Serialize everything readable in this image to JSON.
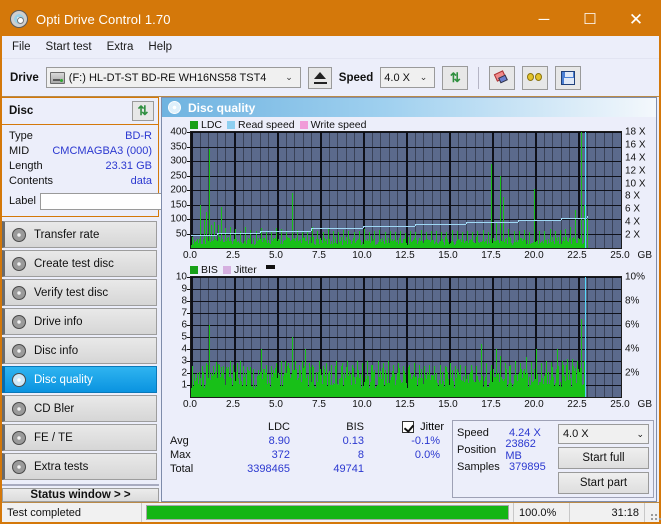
{
  "window": {
    "title": "Opti Drive Control 1.70",
    "icon": "disc-icon",
    "minimize": "─",
    "maximize": "☐",
    "close": "✕"
  },
  "menu": {
    "items": [
      "File",
      "Start test",
      "Extra",
      "Help"
    ]
  },
  "toolbar": {
    "drive_label": "Drive",
    "drive_value": "(F:)  HL-DT-ST BD-RE  WH16NS58 TST4",
    "eject_label": "eject-button",
    "speed_label": "Speed",
    "speed_value": "4.0 X",
    "caret": "⌄",
    "buttons": [
      "refresh-icon",
      "eraser-icon",
      "glasses-icon",
      "save-icon"
    ]
  },
  "disc_panel": {
    "title": "Disc",
    "refresh_icon": "refresh-icon",
    "rows": [
      {
        "key": "Type",
        "value": "BD-R"
      },
      {
        "key": "MID",
        "value": "CMCMAGBA3 (000)"
      },
      {
        "key": "Length",
        "value": "23.31 GB"
      },
      {
        "key": "Contents",
        "value": "data"
      }
    ],
    "label_key": "Label",
    "label_value": "",
    "label_placeholder": ""
  },
  "sidebar": {
    "items": [
      {
        "label": "Transfer rate",
        "active": false
      },
      {
        "label": "Create test disc",
        "active": false
      },
      {
        "label": "Verify test disc",
        "active": false
      },
      {
        "label": "Drive info",
        "active": false
      },
      {
        "label": "Disc info",
        "active": false
      },
      {
        "label": "Disc quality",
        "active": true
      },
      {
        "label": "CD Bler",
        "active": false
      },
      {
        "label": "FE / TE",
        "active": false
      },
      {
        "label": "Extra tests",
        "active": false
      }
    ],
    "status_window": "Status window > >"
  },
  "main": {
    "header_title": "Disc quality"
  },
  "chart_data": [
    {
      "id": "ldc-chart",
      "type": "bar",
      "title": "LDC",
      "xlabel": "GB",
      "ylabel": "LDC",
      "xlim": [
        0.0,
        25.0
      ],
      "ylim": [
        0,
        400
      ],
      "xticks": [
        "0.0",
        "2.5",
        "5.0",
        "7.5",
        "10.0",
        "12.5",
        "15.0",
        "17.5",
        "20.0",
        "22.5",
        "25.0"
      ],
      "xunit": "GB",
      "yticks": [
        400,
        350,
        300,
        250,
        200,
        150,
        100,
        50
      ],
      "y2ticks": [
        "18 X",
        "16 X",
        "14 X",
        "12 X",
        "10 X",
        "8 X",
        "6 X",
        "4 X",
        "2 X"
      ],
      "y2lim": [
        0,
        18
      ],
      "grid": true,
      "legend": [
        {
          "name": "LDC",
          "color": "#18a018"
        },
        {
          "name": "Read speed",
          "color": "#8ecff0"
        },
        {
          "name": "Write speed",
          "color": "#f09cd8"
        }
      ],
      "legend_position": "top-left",
      "series": [
        {
          "name": "LDC",
          "color": "#18c018",
          "baseline": 28,
          "spikes": [
            [
              0.55,
              150
            ],
            [
              0.75,
              95
            ],
            [
              0.85,
              125
            ],
            [
              1.05,
              340
            ],
            [
              1.15,
              78
            ],
            [
              1.35,
              88
            ],
            [
              1.55,
              80
            ],
            [
              1.75,
              140
            ],
            [
              1.95,
              70
            ],
            [
              2.25,
              72
            ],
            [
              2.55,
              66
            ],
            [
              2.85,
              60
            ],
            [
              3.15,
              74
            ],
            [
              3.45,
              62
            ],
            [
              3.75,
              58
            ],
            [
              4.05,
              68
            ],
            [
              4.35,
              56
            ],
            [
              4.65,
              60
            ],
            [
              4.95,
              70
            ],
            [
              5.25,
              64
            ],
            [
              5.55,
              58
            ],
            [
              5.85,
              190
            ],
            [
              6.15,
              62
            ],
            [
              6.45,
              56
            ],
            [
              6.75,
              60
            ],
            [
              7.05,
              72
            ],
            [
              7.35,
              58
            ],
            [
              7.65,
              54
            ],
            [
              7.95,
              66
            ],
            [
              8.25,
              60
            ],
            [
              8.55,
              56
            ],
            [
              8.85,
              62
            ],
            [
              9.15,
              58
            ],
            [
              9.45,
              54
            ],
            [
              9.75,
              60
            ],
            [
              10.05,
              64
            ],
            [
              10.35,
              56
            ],
            [
              10.65,
              58
            ],
            [
              10.95,
              62
            ],
            [
              11.25,
              54
            ],
            [
              11.55,
              60
            ],
            [
              11.85,
              56
            ],
            [
              12.15,
              58
            ],
            [
              12.45,
              52
            ],
            [
              12.75,
              60
            ],
            [
              13.05,
              56
            ],
            [
              13.35,
              62
            ],
            [
              13.65,
              54
            ],
            [
              13.95,
              58
            ],
            [
              14.25,
              60
            ],
            [
              14.55,
              56
            ],
            [
              14.85,
              54
            ],
            [
              15.15,
              62
            ],
            [
              15.45,
              58
            ],
            [
              15.75,
              56
            ],
            [
              16.05,
              60
            ],
            [
              16.35,
              54
            ],
            [
              16.65,
              58
            ],
            [
              16.95,
              62
            ],
            [
              17.25,
              56
            ],
            [
              17.45,
              290
            ],
            [
              17.75,
              90
            ],
            [
              17.95,
              250
            ],
            [
              18.15,
              175
            ],
            [
              18.45,
              64
            ],
            [
              18.75,
              60
            ],
            [
              19.05,
              58
            ],
            [
              19.35,
              62
            ],
            [
              19.65,
              56
            ],
            [
              19.95,
              205
            ],
            [
              20.25,
              60
            ],
            [
              20.55,
              58
            ],
            [
              20.85,
              64
            ],
            [
              21.15,
              58
            ],
            [
              21.45,
              62
            ],
            [
              21.75,
              66
            ],
            [
              22.05,
              72
            ],
            [
              22.35,
              130
            ],
            [
              22.65,
              400
            ],
            [
              22.85,
              150
            ],
            [
              23.0,
              100
            ]
          ]
        },
        {
          "name": "Read speed",
          "color": "#9fd8f5",
          "steps": [
            [
              0.0,
              2.0
            ],
            [
              1.5,
              2.4
            ],
            [
              4.0,
              2.7
            ],
            [
              7.0,
              3.1
            ],
            [
              10.0,
              3.4
            ],
            [
              13.0,
              3.7
            ],
            [
              16.0,
              4.0
            ],
            [
              19.0,
              4.3
            ],
            [
              21.5,
              4.6
            ],
            [
              23.0,
              4.9
            ]
          ]
        },
        {
          "name": "Write speed",
          "color": "#f09cd8",
          "values": []
        }
      ],
      "end_marker": {
        "x": 22.9,
        "color": "#55d8f8"
      }
    },
    {
      "id": "bis-chart",
      "type": "bar",
      "title": "BIS",
      "xlabel": "GB",
      "ylabel": "BIS",
      "xlim": [
        0.0,
        25.0
      ],
      "ylim": [
        0,
        10
      ],
      "xticks": [
        "0.0",
        "2.5",
        "5.0",
        "7.5",
        "10.0",
        "12.5",
        "15.0",
        "17.5",
        "20.0",
        "22.5",
        "25.0"
      ],
      "xunit": "GB",
      "yticks": [
        10,
        9,
        8,
        7,
        6,
        5,
        4,
        3,
        2,
        1
      ],
      "y2ticks": [
        "10%",
        "8%",
        "6%",
        "4%",
        "2%"
      ],
      "y2lim": [
        0,
        10
      ],
      "grid": true,
      "legend": [
        {
          "name": "BIS",
          "color": "#18a018"
        },
        {
          "name": "Jitter",
          "color": "#d6b0e0"
        }
      ],
      "legend_position": "top-left",
      "series": [
        {
          "name": "BIS",
          "color": "#18c018",
          "baseline": 1.9,
          "spikes": [
            [
              0.65,
              2.6
            ],
            [
              0.85,
              2.8
            ],
            [
              1.05,
              6.0
            ],
            [
              1.25,
              2.6
            ],
            [
              1.45,
              2.9
            ],
            [
              1.65,
              2.7
            ],
            [
              1.85,
              2.6
            ],
            [
              2.05,
              2.5
            ],
            [
              2.25,
              3.0
            ],
            [
              2.45,
              2.7
            ],
            [
              2.65,
              2.8
            ],
            [
              2.85,
              3.0
            ],
            [
              3.05,
              2.6
            ],
            [
              3.25,
              2.5
            ],
            [
              4.05,
              4.0
            ],
            [
              4.35,
              2.7
            ],
            [
              4.65,
              2.6
            ],
            [
              4.95,
              2.8
            ],
            [
              5.25,
              3.0
            ],
            [
              5.45,
              3.0
            ],
            [
              5.65,
              2.8
            ],
            [
              5.85,
              5.0
            ],
            [
              6.05,
              3.0
            ],
            [
              6.25,
              2.7
            ],
            [
              6.45,
              3.0
            ],
            [
              6.65,
              4.0
            ],
            [
              6.85,
              2.8
            ],
            [
              7.05,
              2.7
            ],
            [
              7.45,
              3.0
            ],
            [
              7.65,
              2.6
            ],
            [
              7.85,
              2.8
            ],
            [
              8.15,
              2.7
            ],
            [
              8.45,
              3.0
            ],
            [
              8.75,
              2.8
            ],
            [
              9.05,
              3.0
            ],
            [
              9.35,
              2.7
            ],
            [
              9.65,
              3.0
            ],
            [
              9.95,
              2.8
            ],
            [
              10.25,
              3.0
            ],
            [
              10.55,
              2.7
            ],
            [
              10.85,
              3.0
            ],
            [
              11.15,
              2.8
            ],
            [
              11.45,
              3.0
            ],
            [
              11.75,
              2.7
            ],
            [
              12.05,
              2.8
            ],
            [
              12.35,
              2.6
            ],
            [
              12.65,
              2.7
            ],
            [
              12.95,
              2.8
            ],
            [
              13.25,
              2.7
            ],
            [
              13.55,
              2.6
            ],
            [
              13.85,
              2.7
            ],
            [
              14.15,
              2.6
            ],
            [
              14.45,
              2.7
            ],
            [
              14.75,
              2.6
            ],
            [
              15.05,
              2.8
            ],
            [
              15.35,
              2.6
            ],
            [
              15.65,
              2.7
            ],
            [
              15.95,
              2.6
            ],
            [
              16.25,
              2.7
            ],
            [
              16.55,
              2.6
            ],
            [
              16.85,
              4.4
            ],
            [
              17.15,
              2.8
            ],
            [
              17.45,
              2.7
            ],
            [
              17.75,
              4.0
            ],
            [
              17.95,
              3.4
            ],
            [
              18.25,
              2.8
            ],
            [
              18.55,
              2.7
            ],
            [
              18.85,
              3.0
            ],
            [
              19.15,
              2.8
            ],
            [
              19.45,
              3.3
            ],
            [
              19.75,
              2.9
            ],
            [
              20.05,
              4.0
            ],
            [
              20.35,
              2.8
            ],
            [
              20.65,
              3.0
            ],
            [
              20.95,
              2.9
            ],
            [
              21.25,
              4.0
            ],
            [
              21.55,
              3.0
            ],
            [
              21.85,
              3.2
            ],
            [
              22.15,
              3.2
            ],
            [
              22.45,
              3.0
            ],
            [
              22.65,
              6.5
            ],
            [
              22.85,
              3.0
            ]
          ]
        },
        {
          "name": "Jitter",
          "color": "#d6b0e0",
          "values": []
        }
      ],
      "end_marker": {
        "x": 22.9,
        "color": "#55d8f8"
      }
    }
  ],
  "stats": {
    "columns": [
      "",
      "LDC",
      "BIS",
      "Jitter"
    ],
    "jitter_checked": true,
    "jitter_label": "Jitter",
    "rows": [
      {
        "label": "Avg",
        "ldc": "8.90",
        "bis": "0.13",
        "jitter": "-0.1%"
      },
      {
        "label": "Max",
        "ldc": "372",
        "bis": "8",
        "jitter": "0.0%"
      },
      {
        "label": "Total",
        "ldc": "3398465",
        "bis": "49741",
        "jitter": ""
      }
    ]
  },
  "test_info": {
    "speed_label": "Speed",
    "speed_value": "4.24 X",
    "position_label": "Position",
    "position_value": "23862 MB",
    "samples_label": "Samples",
    "samples_value": "379895",
    "speed_select": "4.0 X",
    "caret": "⌄",
    "start_full": "Start full",
    "start_part": "Start part"
  },
  "statusbar": {
    "message": "Test completed",
    "progress_percent": "100.0%",
    "progress_value": 100,
    "elapsed": "31:18"
  }
}
